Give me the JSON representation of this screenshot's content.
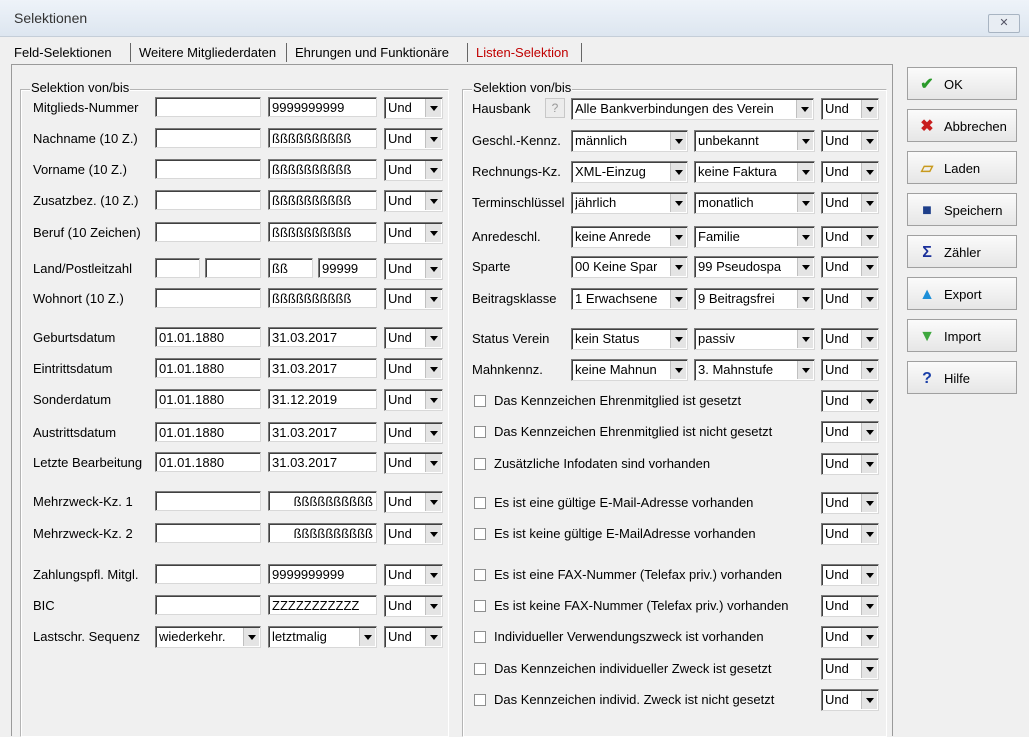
{
  "window": {
    "title": "Selektionen",
    "close_label": "✕"
  },
  "tabs": [
    {
      "label": "Feld-Selektionen"
    },
    {
      "label": "Weitere Mitgliederdaten"
    },
    {
      "label": "Ehrungen und Funktionäre"
    },
    {
      "label": "Listen-Selektion"
    }
  ],
  "left_group": {
    "title": "Selektion von/bis",
    "rows": [
      {
        "label": "Mitglieds-Nummer",
        "from": "",
        "to": "9999999999",
        "op": "Und"
      },
      {
        "label": "Nachname (10 Z.)",
        "from": "",
        "to": "ßßßßßßßßßß",
        "op": "Und"
      },
      {
        "label": "Vorname (10 Z.)",
        "from": "",
        "to": "ßßßßßßßßßß",
        "op": "Und"
      },
      {
        "label": "Zusatzbez. (10 Z.)",
        "from": "",
        "to": "ßßßßßßßßßß",
        "op": "Und"
      },
      {
        "label": "Beruf (10 Zeichen)",
        "from": "",
        "to": "ßßßßßßßßßß",
        "op": "Und"
      },
      {
        "label": "Wohnort (10 Z.)",
        "from": "",
        "to": "ßßßßßßßßßß",
        "op": "Und"
      }
    ],
    "land": {
      "label": "Land/Postleitzahl",
      "land_from": "",
      "plz_from": "",
      "land_to": "ßß",
      "plz_to": "99999",
      "op": "Und"
    },
    "dates": [
      {
        "label": "Geburtsdatum",
        "from": "01.01.1880",
        "to": "31.03.2017",
        "op": "Und"
      },
      {
        "label": "Eintrittsdatum",
        "from": "01.01.1880",
        "to": "31.03.2017",
        "op": "Und"
      },
      {
        "label": "Sonderdatum",
        "from": "01.01.1880",
        "to": "31.12.2019",
        "op": "Und"
      },
      {
        "label": "Austrittsdatum",
        "from": "01.01.1880",
        "to": "31.03.2017",
        "op": "Und"
      },
      {
        "label": "Letzte Bearbeitung",
        "from": "01.01.1880",
        "to": "31.03.2017",
        "op": "Und"
      }
    ],
    "mehrzweck": [
      {
        "label": "Mehrzweck-Kz. 1",
        "from": "",
        "to": "ßßßßßßßßßß",
        "op": "Und"
      },
      {
        "label": "Mehrzweck-Kz. 2",
        "from": "",
        "to": "ßßßßßßßßßß",
        "op": "Und"
      }
    ],
    "zahlung": {
      "label": "Zahlungspfl. Mitgl.",
      "from": "",
      "to": "9999999999",
      "op": "Und"
    },
    "bic": {
      "label": "BIC",
      "from": "",
      "to": "ZZZZZZZZZZZ",
      "op": "Und"
    },
    "lastschrift": {
      "label": "Lastschr. Sequenz",
      "from": "wiederkehr.",
      "to": "letztmalig",
      "op": "Und"
    }
  },
  "right_group": {
    "title": "Selektion von/bis",
    "hausbank": {
      "label": "Hausbank",
      "help": "?",
      "value": "Alle Bankverbindungen des Verein",
      "op": "Und"
    },
    "combos": [
      {
        "label": "Geschl.-Kennz.",
        "from": "männlich",
        "to": "unbekannt",
        "op": "Und"
      },
      {
        "label": "Rechnungs-Kz.",
        "from": "XML-Einzug",
        "to": "keine Faktura",
        "op": "Und"
      },
      {
        "label": "Terminschlüssel",
        "from": "jährlich",
        "to": "monatlich",
        "op": "Und"
      },
      {
        "label": "Anredeschl.",
        "from": "keine Anrede",
        "to": "Familie",
        "op": "Und"
      },
      {
        "label": "Sparte",
        "from": "00 Keine Spar",
        "to": "99 Pseudospa",
        "op": "Und"
      },
      {
        "label": "Beitragsklasse",
        "from": "1 Erwachsene",
        "to": "9 Beitragsfrei",
        "op": "Und"
      }
    ],
    "status": [
      {
        "label": "Status Verein",
        "from": "kein Status",
        "to": "passiv",
        "op": "Und"
      },
      {
        "label": "Mahnkennz.",
        "from": "keine Mahnun",
        "to": "3. Mahnstufe",
        "op": "Und"
      }
    ],
    "checks": [
      {
        "label": "Das Kennzeichen Ehrenmitglied ist gesetzt",
        "op": "Und"
      },
      {
        "label": "Das Kennzeichen Ehrenmitglied ist nicht gesetzt",
        "op": "Und"
      },
      {
        "label": "Zusätzliche Infodaten sind vorhanden",
        "op": "Und"
      },
      {
        "label": "Es ist eine gültige E-Mail-Adresse vorhanden",
        "op": "Und"
      },
      {
        "label": "Es ist keine gültige E-MailAdresse vorhanden",
        "op": "Und"
      },
      {
        "label": "Es ist eine FAX-Nummer (Telefax priv.) vorhanden",
        "op": "Und"
      },
      {
        "label": "Es ist keine FAX-Nummer (Telefax priv.) vorhanden",
        "op": "Und"
      },
      {
        "label": "Individueller Verwendungszweck ist vorhanden",
        "op": "Und"
      },
      {
        "label": "Das Kennzeichen individueller Zweck ist gesetzt",
        "op": "Und"
      },
      {
        "label": "Das Kennzeichen individ. Zweck ist nicht gesetzt",
        "op": "Und"
      }
    ]
  },
  "buttons": [
    {
      "label": "OK",
      "icon": "check-icon"
    },
    {
      "label": "Abbrechen",
      "icon": "cross-icon"
    },
    {
      "label": "Laden",
      "icon": "folder-open-icon"
    },
    {
      "label": "Speichern",
      "icon": "floppy-disk-icon"
    },
    {
      "label": "Zähler",
      "icon": "sigma-icon"
    },
    {
      "label": "Export",
      "icon": "arrow-up-icon"
    },
    {
      "label": "Import",
      "icon": "arrow-down-icon"
    },
    {
      "label": "Hilfe",
      "icon": "help-icon"
    }
  ],
  "colors": {
    "tab_red": "#c00000",
    "ok_green": "#2a9a2a",
    "cancel_red": "#c81e1e"
  }
}
